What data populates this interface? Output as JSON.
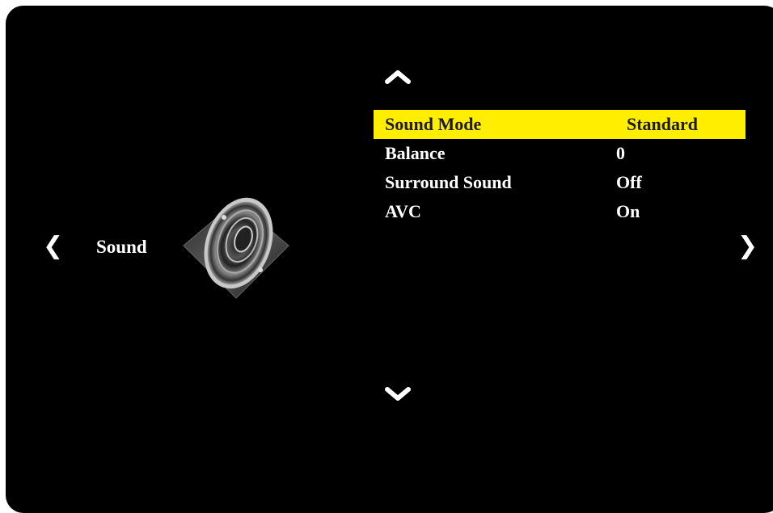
{
  "menu": {
    "category": "Sound",
    "category_icon": "speaker-icon",
    "nav": {
      "left_icon": "chevron-left-icon",
      "right_icon": "chevron-right-icon",
      "up_icon": "chevron-up-icon",
      "down_icon": "chevron-down-icon"
    },
    "items": [
      {
        "label": "Sound Mode",
        "value": "Standard",
        "selected": true
      },
      {
        "label": "Balance",
        "value": "0",
        "selected": false
      },
      {
        "label": "Surround Sound",
        "value": "Off",
        "selected": false
      },
      {
        "label": "AVC",
        "value": "On",
        "selected": false
      }
    ]
  },
  "colors": {
    "background": "#000000",
    "highlight": "#ffee00",
    "text": "#ffffff",
    "highlight_text": "#1a1a1a"
  }
}
